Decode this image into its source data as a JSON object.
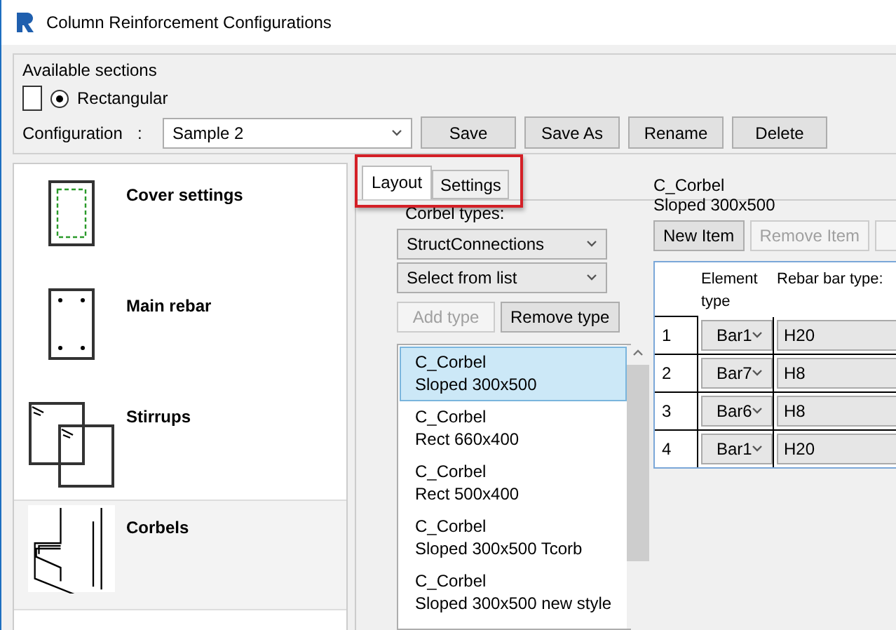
{
  "window": {
    "title": "Column Reinforcement Configurations"
  },
  "available_sections": {
    "label": "Available sections",
    "options": [
      {
        "label": "Rectangular",
        "selected": true
      }
    ]
  },
  "configuration": {
    "label": "Configuration",
    "separator": ":",
    "value": "Sample 2",
    "buttons": [
      "Save",
      "Save As",
      "Rename",
      "Delete"
    ]
  },
  "sidebar": {
    "items": [
      {
        "label": "Cover settings",
        "kind": "cover",
        "selected": false
      },
      {
        "label": "Main rebar",
        "kind": "rebar",
        "selected": false
      },
      {
        "label": "Stirrups",
        "kind": "stirrups",
        "selected": false
      },
      {
        "label": "Corbels",
        "kind": "corbels",
        "selected": true
      }
    ]
  },
  "tabs": [
    {
      "label": "Layout",
      "selected": true
    },
    {
      "label": "Settings",
      "selected": false
    }
  ],
  "corbel_types": {
    "label": "Corbel types:",
    "source": "StructConnections",
    "filter": "Select from list",
    "buttons": [
      {
        "label": "Add type",
        "disabled": true
      },
      {
        "label": "Remove type",
        "disabled": false
      }
    ],
    "items": [
      {
        "name": "C_Corbel",
        "type": "Sloped 300x500",
        "selected": true
      },
      {
        "name": "C_Corbel",
        "type": "Rect 660x400",
        "selected": false
      },
      {
        "name": "C_Corbel",
        "type": "Rect 500x400",
        "selected": false
      },
      {
        "name": "C_Corbel",
        "type": "Sloped 300x500 Tcorb",
        "selected": false
      },
      {
        "name": "C_Corbel",
        "type": "Sloped 300x500 new style",
        "selected": false
      }
    ]
  },
  "details": {
    "name": "C_Corbel",
    "type": "Sloped 300x500",
    "buttons": [
      {
        "label": "New Item",
        "disabled": false
      },
      {
        "label": "Remove Item",
        "disabled": true
      }
    ],
    "table": {
      "columns": [
        "Element type",
        "Rebar bar type:"
      ],
      "rows": [
        {
          "index": "1",
          "element": "Bar1",
          "bar_type": "H20"
        },
        {
          "index": "2",
          "element": "Bar7",
          "bar_type": "H8"
        },
        {
          "index": "3",
          "element": "Bar6",
          "bar_type": "H8"
        },
        {
          "index": "4",
          "element": "Bar1",
          "bar_type": "H20"
        }
      ]
    }
  }
}
